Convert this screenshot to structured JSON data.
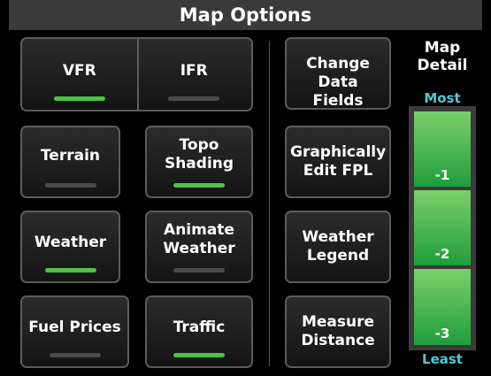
{
  "title": "Map Options",
  "mode_toggle": {
    "vfr": {
      "label": "VFR",
      "active": true
    },
    "ifr": {
      "label": "IFR",
      "active": false
    }
  },
  "toggles": [
    {
      "label": "Terrain",
      "active": false
    },
    {
      "label": "Topo Shading",
      "active": true
    },
    {
      "label": "Weather",
      "active": true
    },
    {
      "label": "Animate Weather",
      "active": false
    },
    {
      "label": "Fuel Prices",
      "active": false
    },
    {
      "label": "Traffic",
      "active": true
    }
  ],
  "actions": [
    {
      "label": "Change Data Fields"
    },
    {
      "label": "Graphically Edit FPL"
    },
    {
      "label": "Weather Legend"
    },
    {
      "label": "Measure Distance"
    }
  ],
  "map_detail": {
    "title": "Map Detail",
    "most_label": "Most",
    "least_label": "Least",
    "levels": [
      "-1",
      "-2",
      "-3"
    ],
    "selected": "-3"
  },
  "colors": {
    "indicator_on": "#4cc441",
    "indicator_off": "#4a4a4a",
    "accent_cyan": "#4fc9d6"
  }
}
